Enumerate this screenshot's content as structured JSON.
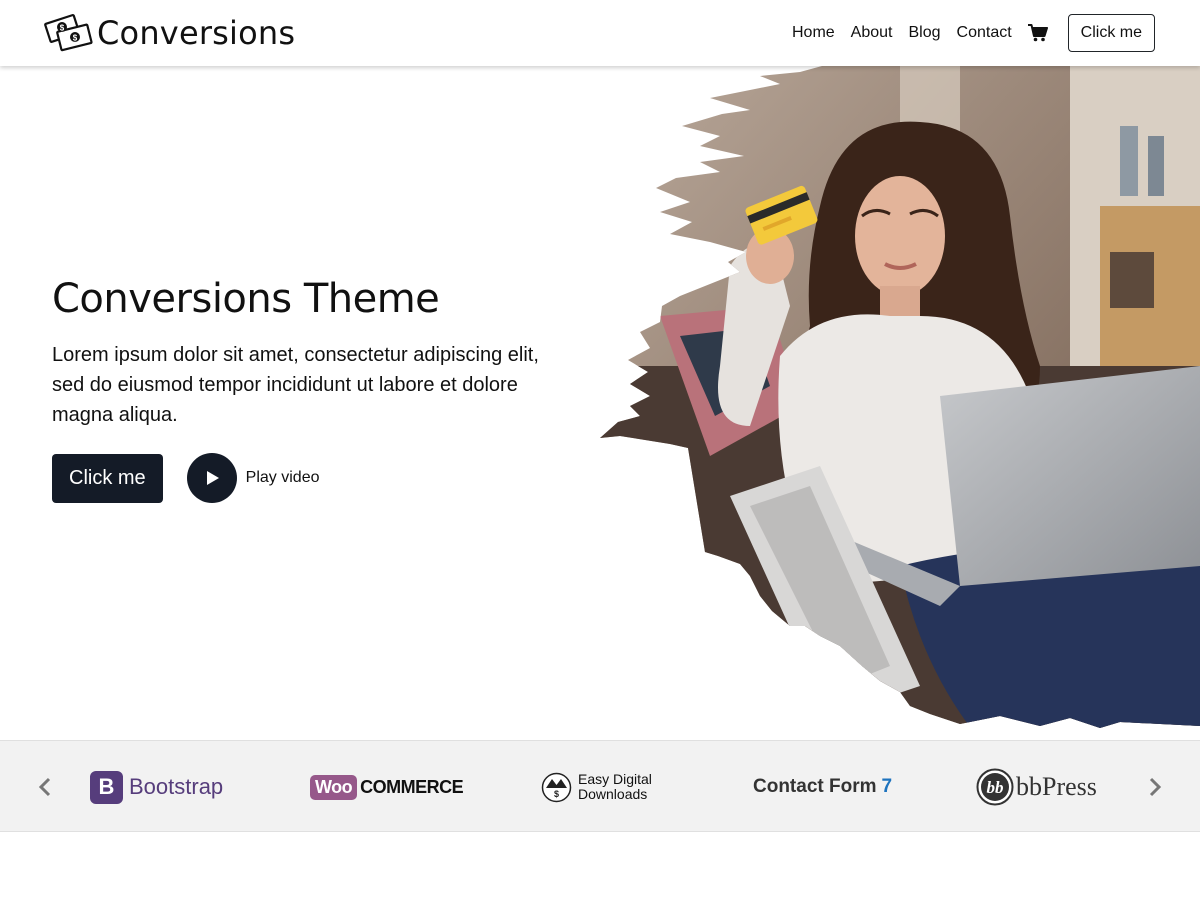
{
  "header": {
    "brand_name": "Conversions",
    "nav": [
      "Home",
      "About",
      "Blog",
      "Contact"
    ],
    "cart_icon": "cart-icon",
    "button_label": "Click me"
  },
  "hero": {
    "title": "Conversions Theme",
    "lead": "Lorem ipsum dolor sit amet, consectetur adipiscing elit, sed do eiusmod tempor incididunt ut labore et dolore magna aliqua.",
    "cta_label": "Click me",
    "video_label": "Play video",
    "image_description_icon": "woman-with-credit-card-photo"
  },
  "logos": {
    "items": [
      {
        "name": "Bootstrap",
        "badge": "B"
      },
      {
        "name": "COMMERCE",
        "badge": "Woo"
      },
      {
        "name_line1": "Easy Digital",
        "name_line2": "Downloads"
      },
      {
        "name": "Contact Form",
        "suffix": "7"
      },
      {
        "name": "bbPress"
      }
    ],
    "prev_icon": "chevron-left-icon",
    "next_icon": "chevron-right-icon"
  },
  "colors": {
    "dark": "#141b27",
    "bootstrap_purple": "#563d7c",
    "woo_purple": "#96588a",
    "strip_bg": "#f2f2f2"
  }
}
